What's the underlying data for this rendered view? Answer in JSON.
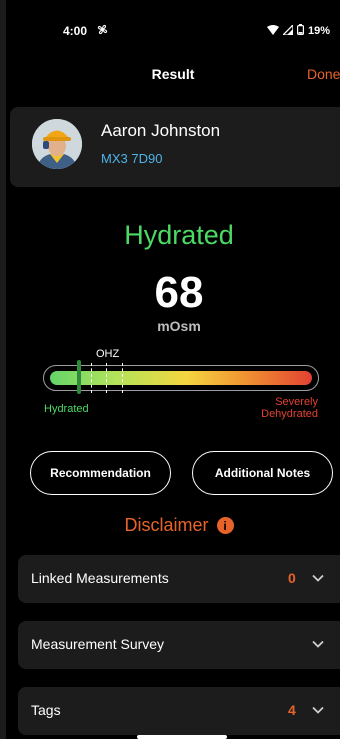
{
  "status_bar": {
    "time": "4:00",
    "battery": "19%"
  },
  "nav": {
    "title": "Result",
    "done_label": "Done"
  },
  "user": {
    "name": "Aaron Johnston",
    "id": "MX3 7D90"
  },
  "result": {
    "status": "Hydrated",
    "value": "68",
    "unit": "mOsm",
    "gauge_label": "OHZ",
    "gauge_level_fraction": 0.11,
    "low_label": "Hydrated",
    "high_label_line1": "Severely",
    "high_label_line2": "Dehydrated"
  },
  "actions": {
    "recommendation_label": "Recommendation",
    "notes_label": "Additional Notes"
  },
  "disclaimer": {
    "label": "Disclaimer"
  },
  "sections": [
    {
      "label": "Linked Measurements",
      "count": "0"
    },
    {
      "label": "Measurement Survey",
      "count": ""
    },
    {
      "label": "Tags",
      "count": "4"
    }
  ],
  "colors": {
    "accent": "#e8632a",
    "good": "#4cd964",
    "bad": "#e24232",
    "link": "#4fb3e8"
  },
  "icons": [
    "fan-icon",
    "wifi-icon",
    "signal-icon",
    "battery-icon",
    "avatar",
    "info-icon",
    "chevron-down-icon"
  ]
}
